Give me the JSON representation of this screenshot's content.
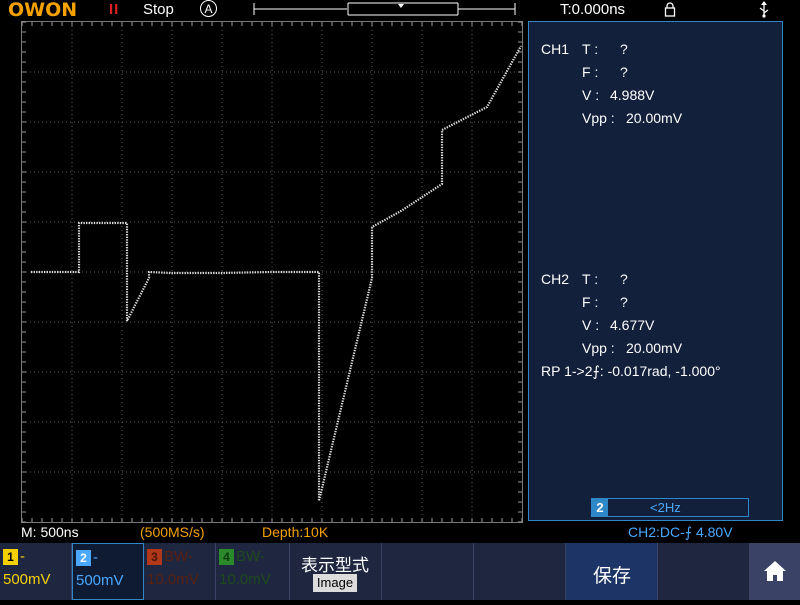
{
  "topbar": {
    "logo": "OWON",
    "pause_glyph": "II",
    "run_status": "Stop",
    "trigger_mode_icon": "A",
    "trigger_time": "T:0.000ns",
    "icons": [
      "pause-icon",
      "auto-trigger-icon",
      "memory-position-bar",
      "lock-icon",
      "usb-icon"
    ]
  },
  "status": {
    "timebase": "M: 500ns",
    "sample_rate": "(500MS/s)",
    "depth": "Depth:10K",
    "trigger": "CH2:DC-⨍ 4.80V"
  },
  "measurements": {
    "ch1": {
      "label": "CH1",
      "t_label": "T :",
      "t_value": "?",
      "f_label": "F :",
      "f_value": "?",
      "v_label": "V :",
      "v_value": "4.988V",
      "vpp_label": "Vpp :",
      "vpp_value": "20.00mV"
    },
    "ch2": {
      "label": "CH2",
      "t_label": "T :",
      "t_value": "?",
      "f_label": "F :",
      "f_value": "?",
      "v_label": "V :",
      "v_value": "4.677V",
      "vpp_label": "Vpp :",
      "vpp_value": "20.00mV"
    },
    "phase": "RP 1->2⨍: -0.017rad, -1.000°",
    "ch2_freq_badge": "2",
    "ch2_freq_value": "<2Hz"
  },
  "menu": {
    "ch1": {
      "badge": "1",
      "top": "-",
      "bottom": "500mV",
      "color": "#f5d000"
    },
    "ch2": {
      "badge": "2",
      "top": "-",
      "bottom": "500mV",
      "color": "#4aa8ff"
    },
    "ch3": {
      "badge": "3",
      "top": "BW-",
      "bottom": "10.0mV",
      "color": "#b03818"
    },
    "ch4": {
      "badge": "4",
      "top": "BW-",
      "bottom": "10.0mV",
      "color": "#2a8a2a"
    },
    "display_title": "表示型式",
    "display_value": "Image",
    "save_label": "保存",
    "home_icon": "home-icon"
  },
  "colors": {
    "trace": "#dcdcdc",
    "grid": "#5a5a5a",
    "panel_border": "#2e88c8",
    "accent_orange": "#f5a100"
  }
}
